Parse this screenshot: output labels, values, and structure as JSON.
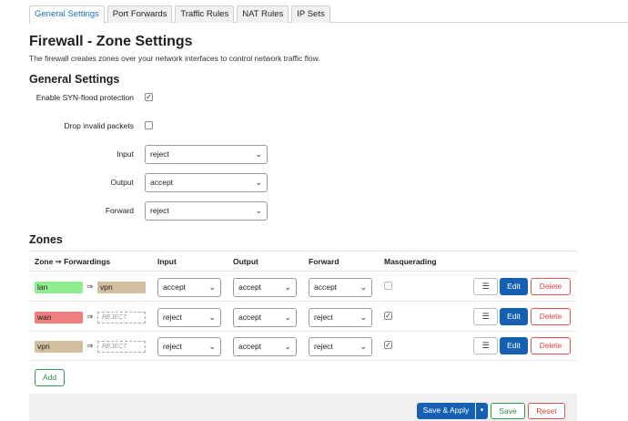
{
  "tabs": [
    "General Settings",
    "Port Forwards",
    "Traffic Rules",
    "NAT Rules",
    "IP Sets"
  ],
  "page": {
    "title": "Firewall - Zone Settings",
    "description": "The firewall creates zones over your network interfaces to control network traffic flow."
  },
  "general": {
    "heading": "General Settings",
    "synflood_label": "Enable SYN-flood protection",
    "synflood_checked": "✓",
    "drop_invalid_label": "Drop invalid packets",
    "drop_invalid_checked": "",
    "input_label": "Input",
    "input_value": "reject",
    "output_label": "Output",
    "output_value": "accept",
    "forward_label": "Forward",
    "forward_value": "reject"
  },
  "zones": {
    "heading": "Zones",
    "columns": [
      "Zone ⇒ Forwardings",
      "Input",
      "Output",
      "Forward",
      "Masquerading"
    ],
    "arrow": "⇒",
    "rows": [
      {
        "name": "lan",
        "color": "#90ee90",
        "forward_to": "vpn",
        "forward_color": "#d2bf9f",
        "forward_reject": false,
        "input": "accept",
        "output": "accept",
        "forward": "accept",
        "masq": ""
      },
      {
        "name": "wan",
        "color": "#f08080",
        "forward_to": "REJECT",
        "forward_color": "#ffffff",
        "forward_reject": true,
        "input": "reject",
        "output": "accept",
        "forward": "reject",
        "masq": "✓"
      },
      {
        "name": "vpn",
        "color": "#d2bf9f",
        "forward_to": "REJECT",
        "forward_color": "#ffffff",
        "forward_reject": true,
        "input": "reject",
        "output": "accept",
        "forward": "reject",
        "masq": "✓"
      }
    ],
    "menu_icon": "☰",
    "edit_label": "Edit",
    "delete_label": "Delete",
    "add_label": "Add"
  },
  "footer": {
    "save_apply_label": "Save & Apply",
    "caret": "▾",
    "save_label": "Save",
    "reset_label": "Reset"
  },
  "chevron": "⌄"
}
